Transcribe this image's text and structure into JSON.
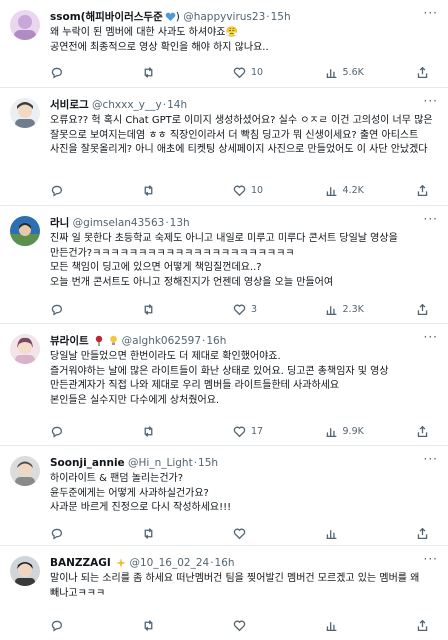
{
  "tweets": [
    {
      "name": "ssom(해피바이러스두준",
      "handle": "@happyvirus23",
      "time": "15h",
      "text": "왜 누락이 된 멤버에 대한 사과도 하셔야죠😤\n공연전에 최종적으로 영상 확인을 해야 하지 않나요..",
      "replies": "",
      "retweets": "",
      "likes": "10",
      "views": "5.6K",
      "avatar_color": "#c9a7d8"
    },
    {
      "name": "서비로그",
      "handle": "@chxxx_y__y",
      "time": "14h",
      "text": "오류요?? 헉 혹시 Chat GPT로 이미지 생성하셨어요? 실수 ㅇㅈㄹ 이건 고의성이 너무 많은 잘못으로 보여지는데염 ㅎㅎ 직장인이라서 더 빡침 딩고가 뭐 신생이세요? 출연 아티스트 사진을 잘못올리게? 아니 애초에 티켓팅 상세페이지 사진으로 만들었어도 이 사단 안났겠다",
      "replies": "",
      "retweets": "",
      "likes": "10",
      "views": "4.2K",
      "avatar_color": "#b9c2cc"
    },
    {
      "name": "라니",
      "handle": "@gimselan43563",
      "time": "13h",
      "text": "진짜 일 못한다 초등학교 숙제도 아니고 내일로 미루고 미루다 콘서트 당일날 영상을 만든건가?ㅋㅋㅋㅋㅋㅋㅋㅋㅋㅋㅋㅋㅋㅋㅋㅋㅋㅋㅋㅋㅋㅋ\n모든 책임이 딩고에 있으면 어떻게 책임질껀데요..?\n오늘 번개 콘서트도 아니고 정해진지가 언젠데 영상을 오늘 만들어여",
      "replies": "",
      "retweets": "",
      "likes": "3",
      "views": "2.3K",
      "avatar_color": "#2c6fb3"
    },
    {
      "name": "뷰라이트",
      "handle": "@alghk062597",
      "time": "16h",
      "text": "당일날 만들었으면 한번이라도 더 제대로 확인했어야죠.\n즐거워야하는 날에 많은 라이트들이 화난 상태로 있어요. 딩고콘 총책임자 및 영상 만든관계자가 직접 나와 제대로 우리 멤버들 라이트들한테 사과하세요\n본인들은 실수지만 다수에게 상처줬어요.",
      "replies": "",
      "retweets": "",
      "likes": "17",
      "views": "9.9K",
      "avatar_color": "#d9b3c7"
    },
    {
      "name": "Soonji_annie",
      "handle": "@Hi_n_Light",
      "time": "15h",
      "text": "하이라이트 & 팬덤 놀리는건가?\n윤두준에게는 어떻게 사과하실건가요?\n사과문 바르게 진정으로 다시 작성하세요!!!",
      "replies": "",
      "retweets": "",
      "likes": "",
      "views": "",
      "avatar_color": "#a7a7a7"
    },
    {
      "name": "BANZZAGI",
      "handle": "@10_16_02_24",
      "time": "16h",
      "text": "말이나 되는 소리를 좀 하세요 떠난멤버건 팀을 찢어발긴 멤버건 모르겠고 있는 멤버를 왜 빼나고ㅋㅋㅋ",
      "replies": "",
      "retweets": "",
      "likes": "",
      "views": "",
      "avatar_color": "#3a3a3a"
    }
  ]
}
